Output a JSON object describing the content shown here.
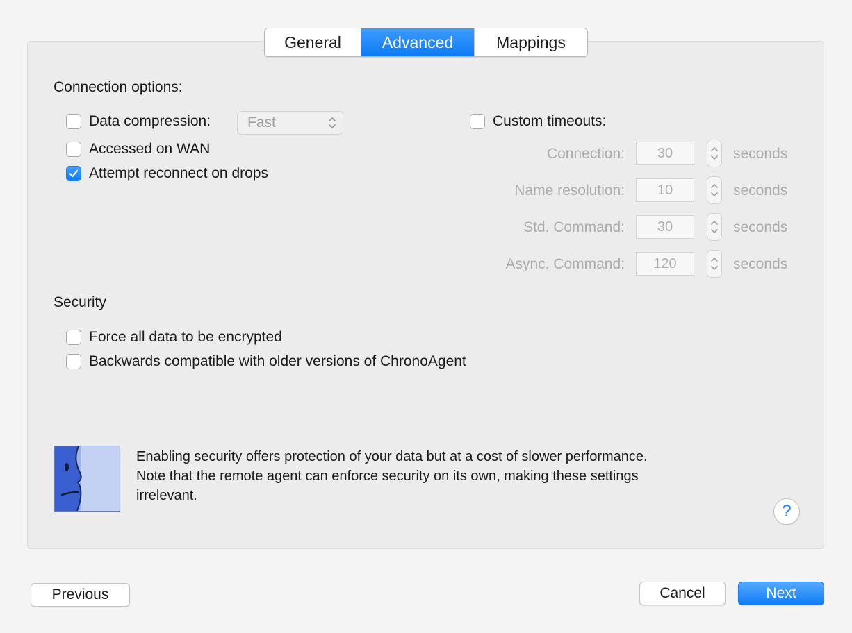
{
  "tabs": [
    {
      "label": "General",
      "active": false
    },
    {
      "label": "Advanced",
      "active": true
    },
    {
      "label": "Mappings",
      "active": false
    }
  ],
  "connection": {
    "title": "Connection options:",
    "data_compression": {
      "label": "Data compression:",
      "checked": false,
      "value": "Fast"
    },
    "accessed_on_wan": {
      "label": "Accessed on WAN",
      "checked": false
    },
    "attempt_reconnect": {
      "label": "Attempt reconnect on drops",
      "checked": true
    },
    "custom_timeouts": {
      "label": "Custom timeouts:",
      "checked": false,
      "rows": [
        {
          "label": "Connection:",
          "value": "30",
          "unit": "seconds"
        },
        {
          "label": "Name resolution:",
          "value": "10",
          "unit": "seconds"
        },
        {
          "label": "Std. Command:",
          "value": "30",
          "unit": "seconds"
        },
        {
          "label": "Async. Command:",
          "value": "120",
          "unit": "seconds"
        }
      ]
    }
  },
  "security": {
    "title": "Security",
    "force_encrypt": {
      "label": "Force all data to be encrypted",
      "checked": false
    },
    "backwards_compat": {
      "label": "Backwards compatible with older versions of ChronoAgent",
      "checked": false
    }
  },
  "info": {
    "icon": "finder-icon",
    "line1": "Enabling security offers protection of your data but at a cost of slower performance.",
    "line2": "Note that the remote agent can enforce security on its own, making these settings",
    "line3": "irrelevant."
  },
  "help": {
    "label": "?"
  },
  "buttons": {
    "previous": "Previous",
    "cancel": "Cancel",
    "next": "Next"
  },
  "colors": {
    "accent": "#0b7bf5",
    "disabled_text": "#ababab"
  }
}
